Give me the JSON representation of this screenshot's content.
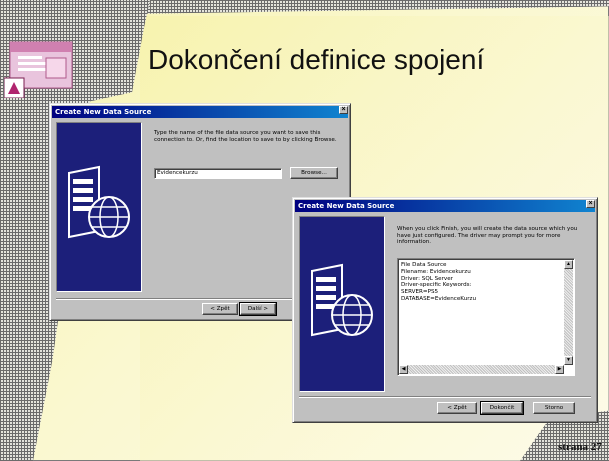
{
  "slide": {
    "title": "Dokončení definice spojení",
    "page_number": "strana 27",
    "colors": {
      "background": "#f7f3b0",
      "grid": "#6b6b6b",
      "titlebar": "#000080",
      "wizard_panel": "#1c1f7a"
    }
  },
  "dialog1": {
    "title": "Create New Data Source",
    "instruction": "Type the name of the file data source you want to save this connection to. Or, find the location to save to by clicking Browse.",
    "filename_value": "Evidencekurzu",
    "browse_label": "Browse...",
    "back_label": "< Zpět",
    "next_label": "Další >",
    "close_label": "×"
  },
  "dialog2": {
    "title": "Create New Data Source",
    "instruction": "When you click Finish, you will create the data source which you have just configured. The driver may prompt you for more information.",
    "summary_lines": [
      "File Data Source",
      "Filename: Evidencekurzu",
      "Driver: SQL Server",
      "Driver-specific Keywords:",
      "SERVER=PS5",
      "DATABASE=EvidenceKurzu"
    ],
    "back_label": "< Zpět",
    "finish_label": "Dokončit",
    "cancel_label": "Storno",
    "close_label": "×"
  },
  "icons": [
    "access-logo-icon",
    "data-source-globe-icon",
    "close-icon",
    "scroll-up-icon",
    "scroll-down-icon",
    "scroll-left-icon",
    "scroll-right-icon"
  ]
}
